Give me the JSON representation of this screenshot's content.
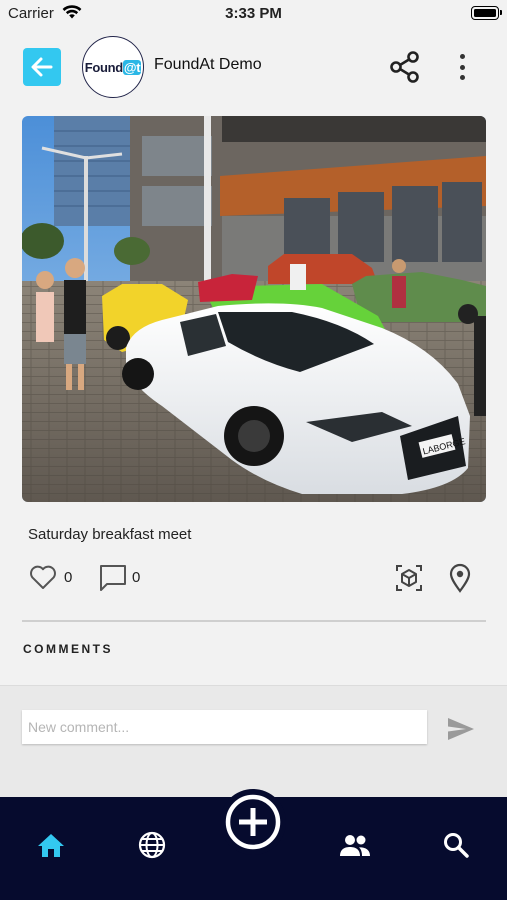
{
  "status_bar": {
    "carrier": "Carrier",
    "time": "3:33 PM"
  },
  "header": {
    "title": "FoundAt Demo",
    "avatar_text": "Found",
    "avatar_at": "@t"
  },
  "post": {
    "caption": "Saturday breakfast meet",
    "likes": "0",
    "comments": "0",
    "photo_plate_text": "LABORGE"
  },
  "comments_section": {
    "label": "COMMENTS"
  },
  "comment_input": {
    "placeholder": "New comment..."
  },
  "icons": {
    "back": "arrow-left-icon",
    "share": "share-icon",
    "more": "more-vertical-icon",
    "like": "heart-icon",
    "comment": "comment-icon",
    "ar": "cube-icon",
    "location": "location-pin-icon",
    "send": "send-icon",
    "home": "home-icon",
    "explore": "globe-icon",
    "add": "plus-circle-icon",
    "friends": "people-icon",
    "search": "search-icon"
  },
  "colors": {
    "accent": "#33c8f0",
    "nav_bg": "#060b2e",
    "nav_inactive": "#ffffff"
  }
}
